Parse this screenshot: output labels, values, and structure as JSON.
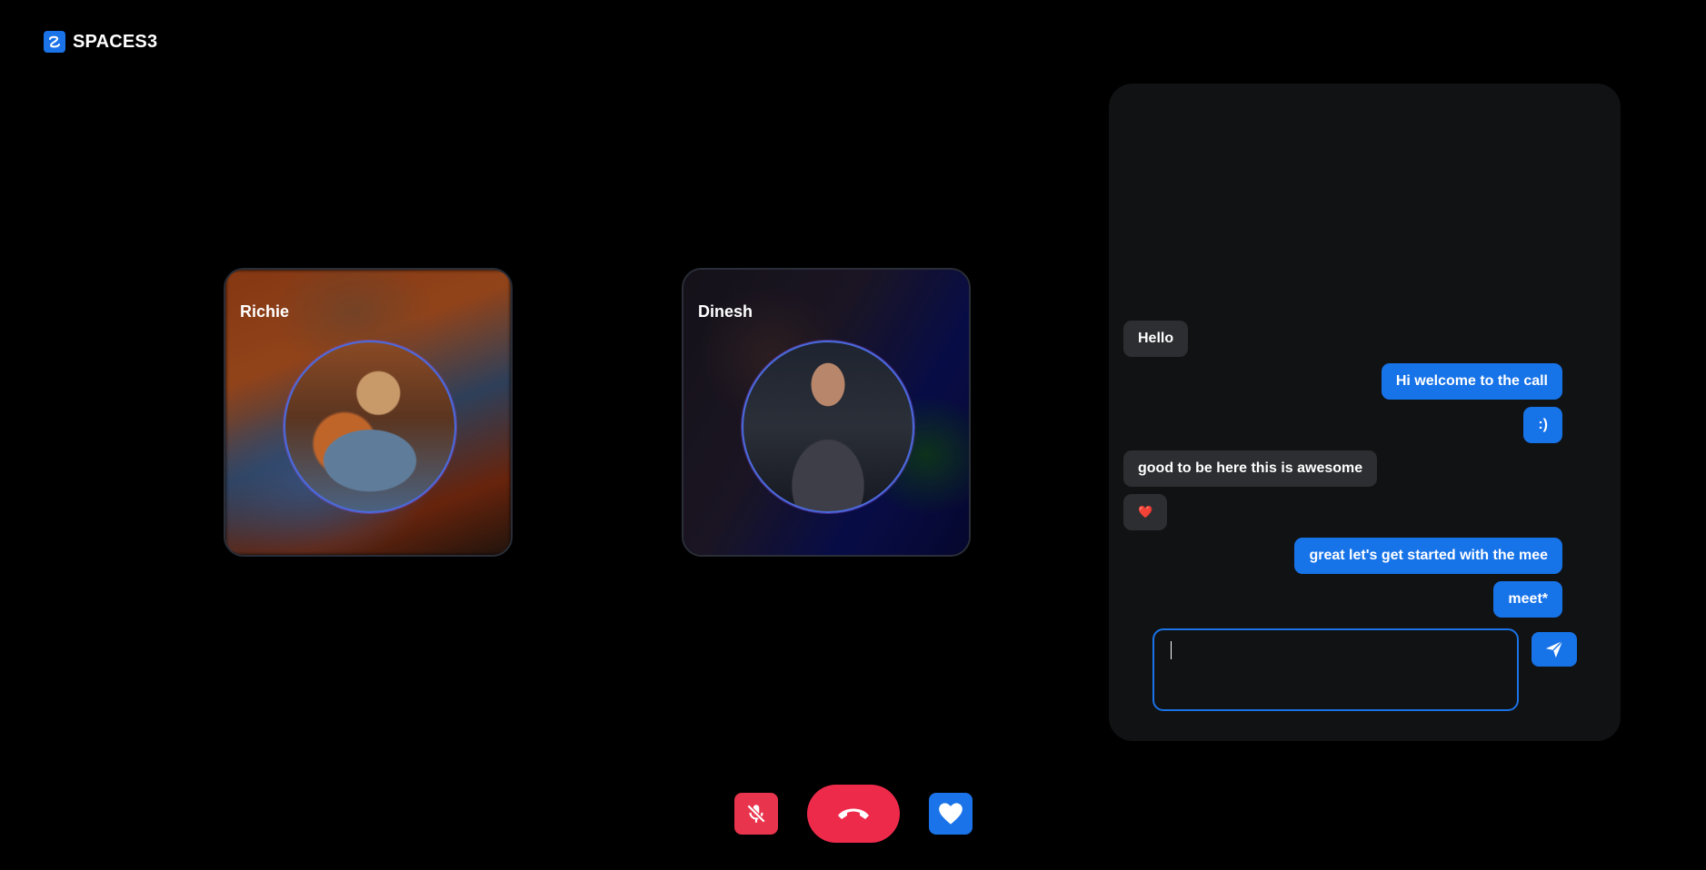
{
  "app": {
    "name": "SPACES3"
  },
  "participants": [
    {
      "name": "Richie"
    },
    {
      "name": "Dinesh"
    }
  ],
  "controls": {
    "mute_icon": "mic-off-icon",
    "hangup_icon": "phone-hangup-icon",
    "react_icon": "heart-icon"
  },
  "chat": {
    "messages": [
      {
        "direction": "in",
        "text": "Hello"
      },
      {
        "direction": "out",
        "text": "Hi welcome to the call"
      },
      {
        "direction": "out",
        "text": ":)"
      },
      {
        "direction": "in",
        "text": "good to be here this is awesome"
      },
      {
        "direction": "in",
        "text": "❤️"
      },
      {
        "direction": "out",
        "text": "great let's get started with the mee"
      },
      {
        "direction": "out",
        "text": "meet*"
      }
    ],
    "input_value": "",
    "send_icon": "send-icon"
  },
  "colors": {
    "accent": "#1773e8",
    "danger": "#ee2a4b",
    "panel_bg": "#111213",
    "incoming_bubble": "#2c2e31"
  }
}
